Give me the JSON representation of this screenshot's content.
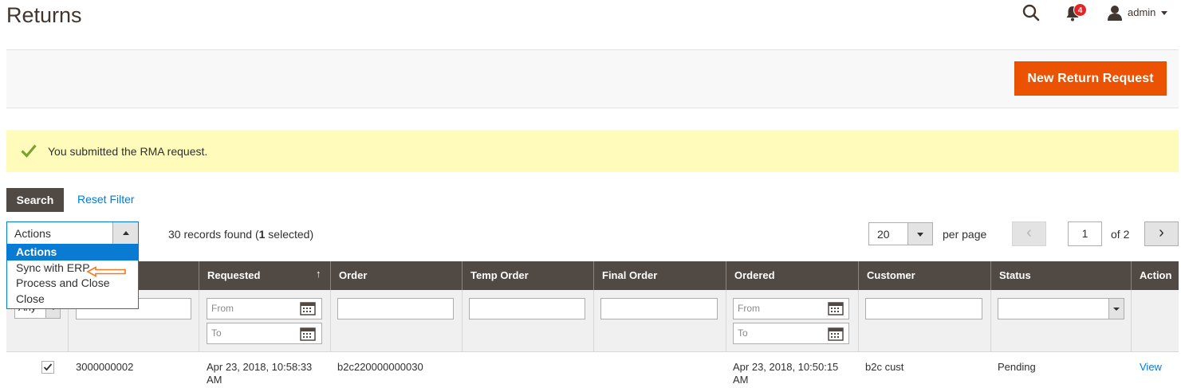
{
  "page": {
    "title": "Returns"
  },
  "header": {
    "user": "admin",
    "notifications_count": "4"
  },
  "toolbar": {
    "new_button": "New Return Request"
  },
  "message": {
    "text": "You submitted the RMA request."
  },
  "filters": {
    "search_button": "Search",
    "reset_link": "Reset Filter"
  },
  "mass_actions": {
    "selected": "Actions",
    "options": [
      "Actions",
      "Sync with ERP",
      "Process and Close",
      "Close"
    ]
  },
  "records": {
    "prefix": "30 records found (",
    "selected_count": "1",
    "suffix": " selected)"
  },
  "pagination": {
    "per_page_value": "20",
    "per_page_label": "per page",
    "current_page": "1",
    "of_label": "of 2"
  },
  "grid": {
    "columns": [
      "Requested",
      "Order",
      "Temp Order",
      "Final Order",
      "Ordered",
      "Customer",
      "Status",
      "Action"
    ],
    "filter_any": "Any",
    "from_placeholder": "From",
    "to_placeholder": "To",
    "rows": [
      {
        "id": "3000000002",
        "requested": "Apr 23, 2018, 10:58:33",
        "requested_ampm": "AM",
        "order": "b2c220000000030",
        "temp_order": "",
        "final_order": "",
        "ordered": "Apr 23, 2018, 10:50:15",
        "ordered_ampm": "AM",
        "customer": "b2c cust",
        "status": "Pending",
        "action": "View"
      }
    ]
  },
  "colors": {
    "accent": "#eb5202",
    "header_bg": "#514943",
    "link": "#007bdb",
    "message_bg": "#fffbbb"
  }
}
